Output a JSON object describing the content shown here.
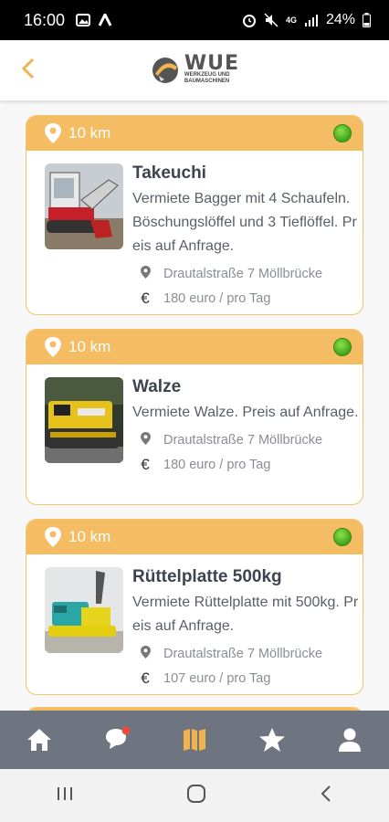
{
  "status": {
    "time": "16:00",
    "network": "4G",
    "battery": "24%"
  },
  "header": {
    "logo_word": "WUE",
    "logo_sub1": "WERKZEUG UND",
    "logo_sub2": "BAUMASCHINEN"
  },
  "listings": [
    {
      "distance": "10 km",
      "title": "Takeuchi",
      "description": "Vermiete Bagger mit 4 Schaufeln. Böschungslöffel und 3 Tieflöffel. Preis auf Anfrage.",
      "address": "Drautalstraße 7 Möllbrücke",
      "price": "180 euro / pro Tag"
    },
    {
      "distance": "10 km",
      "title": "Walze",
      "description": "Vermiete Walze. Preis auf Anfrage.",
      "address": "Drautalstraße 7 Möllbrücke",
      "price": "180 euro / pro Tag"
    },
    {
      "distance": "10 km",
      "title": "Rüttelplatte 500kg",
      "description": "Vermiete Rüttelplatte mit 500kg. Preis auf Anfrage.",
      "address": "Drautalstraße 7 Möllbrücke",
      "price": "107 euro / pro Tag"
    }
  ],
  "colors": {
    "accent": "#f4bc63",
    "nav": "#6e7480",
    "active_nav": "#f0b34e"
  }
}
